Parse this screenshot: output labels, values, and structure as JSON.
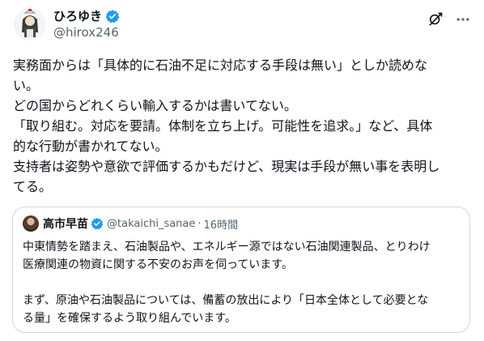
{
  "author": {
    "display_name": "ひろゆき",
    "handle": "@hirox246",
    "verified": true
  },
  "icons": {
    "grok": "grok-icon",
    "more": "more-options-icon",
    "verified": "verified-badge-icon"
  },
  "colors": {
    "verified_blue": "#1d9bf0",
    "secondary_text": "#536471",
    "border": "#cfd9de"
  },
  "tweet": {
    "lines": [
      "実務面からは「具体的に石油不足に対応する手段は無い」としか読めな",
      "い。",
      "どの国からどれくらい輸入するかは書いてない。",
      "「取り組む。対応を要請。体制を立ち上げ。可能性を追求。」など、具体",
      "的な行動が書かれてない。",
      "支持者は姿勢や意欲で評価するかもだけど、現実は手段が無い事を表明し",
      "てる。"
    ]
  },
  "quote": {
    "display_name": "高市早苗",
    "handle": "@takaichi_sanae",
    "separator": "·",
    "time": "16時間",
    "verified": true,
    "paragraph1": [
      "中東情勢を踏まえ、石油製品や、エネルギー源ではない石油関連製品、とりわけ",
      "医療関連の物資に関する不安のお声を伺っています。"
    ],
    "paragraph2": [
      "まず、原油や石油製品については、備蓄の放出により「日本全体として必要とな",
      "る量」を確保するよう取り組んでいます。"
    ]
  }
}
